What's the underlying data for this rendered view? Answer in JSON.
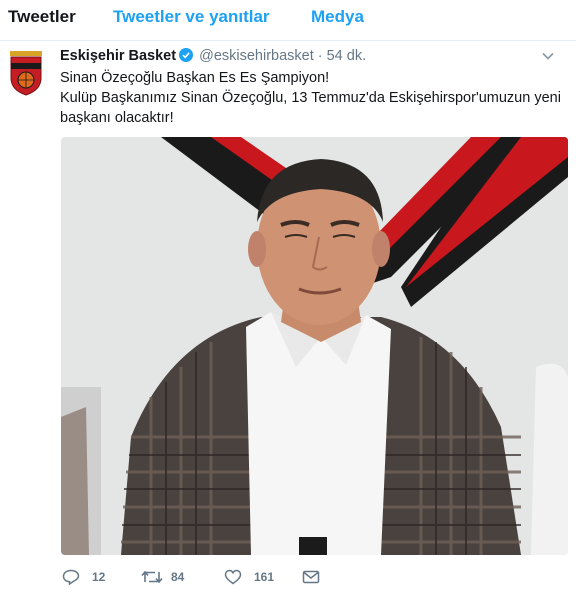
{
  "tabs": [
    {
      "label": "Tweetler",
      "active": true
    },
    {
      "label": "Tweetler ve yanıtlar",
      "active": false
    },
    {
      "label": "Medya",
      "active": false
    }
  ],
  "tweet": {
    "author_name": "Eskişehir Basket",
    "handle": "@eskisehirbasket",
    "separator": "·",
    "time": "54 dk.",
    "verified": true,
    "text_lines": [
      "Sinan Özeçoğlu Başkan Es Es Şampiyon!",
      "Kulüp Başkanımız Sinan Özeçoğlu, 13 Temmuz'da Eskişehirspor'umuzun yeni",
      "başkanı olacaktır!"
    ],
    "actions": {
      "replies": "12",
      "retweets": "84",
      "likes": "161"
    }
  },
  "colors": {
    "accent": "#1da1f2",
    "muted": "#657786",
    "text": "#14171a"
  },
  "icons": {
    "verified": "verified-badge-icon",
    "more": "chevron-down-icon",
    "reply": "reply-icon",
    "retweet": "retweet-icon",
    "like": "heart-icon",
    "dm": "envelope-icon"
  }
}
